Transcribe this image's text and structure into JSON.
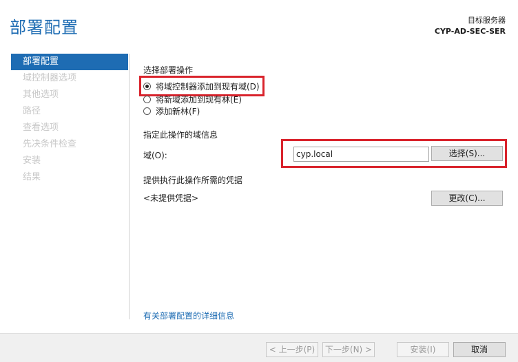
{
  "header": {
    "title": "部署配置",
    "target_label": "目标服务器",
    "target_server": "CYP-AD-SEC-SER"
  },
  "nav": {
    "items": [
      {
        "label": "部署配置",
        "active": true
      },
      {
        "label": "域控制器选项",
        "active": false
      },
      {
        "label": "其他选项",
        "active": false
      },
      {
        "label": "路径",
        "active": false
      },
      {
        "label": "查看选项",
        "active": false
      },
      {
        "label": "先决条件检查",
        "active": false
      },
      {
        "label": "安装",
        "active": false
      },
      {
        "label": "结果",
        "active": false
      }
    ]
  },
  "content": {
    "operation_heading": "选择部署操作",
    "options": [
      {
        "label": "将域控制器添加到现有域(D)",
        "checked": true
      },
      {
        "label": "将新域添加到现有林(E)",
        "checked": false
      },
      {
        "label": "添加新林(F)",
        "checked": false
      }
    ],
    "domain_info_heading": "指定此操作的域信息",
    "domain_label": "域(O):",
    "domain_value": "cyp.local",
    "select_button": "选择(S)...",
    "credentials_heading": "提供执行此操作所需的凭据",
    "credentials_value": "<未提供凭据>",
    "change_button": "更改(C)...",
    "more_info_link": "有关部署配置的详细信息"
  },
  "footer": {
    "prev": "< 上一步(P)",
    "next": "下一步(N) >",
    "install": "安装(I)",
    "cancel": "取消"
  },
  "colors": {
    "accent": "#1e6cb3",
    "highlight_box": "#d9232c"
  }
}
